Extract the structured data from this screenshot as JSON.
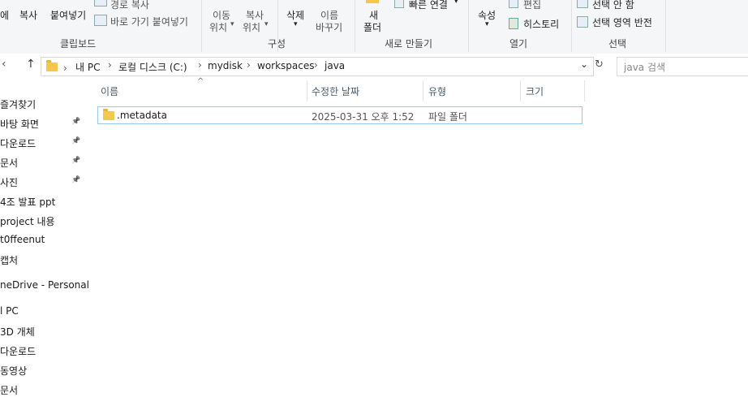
{
  "ribbon": {
    "clipboard": {
      "partial_label": "에",
      "copy": "복사",
      "paste": "붙여넣기",
      "copy_path": "경로 복사",
      "paste_shortcut": "바로 가기 붙여넣기",
      "group": "클립보드"
    },
    "organize": {
      "move_to": [
        "이동",
        "위치"
      ],
      "copy_to": [
        "복사",
        "위치"
      ],
      "delete": "삭제",
      "rename": [
        "이름",
        "바꾸기"
      ],
      "group": "구성"
    },
    "new": {
      "new_folder": [
        "새",
        "폴더"
      ],
      "easy_access": "빠른 연결",
      "group": "새로 만들기"
    },
    "open": {
      "properties": "속성",
      "edit": "편집",
      "history": "히스토리",
      "group": "열기"
    },
    "select": {
      "select_none": "선택 안 함",
      "invert": "선택 영역 반전",
      "group": "선택"
    }
  },
  "address": {
    "crumbs": [
      "내 PC",
      "로컬 디스크 (C:)",
      "mydisk",
      "workspaces",
      "java"
    ],
    "search_placeholder": "java 검색"
  },
  "nav": {
    "items": [
      {
        "label": "즐겨찾기",
        "pinned": false
      },
      {
        "label": "바탕 화면",
        "pinned": true
      },
      {
        "label": "다운로드",
        "pinned": true
      },
      {
        "label": "문서",
        "pinned": true
      },
      {
        "label": "사진",
        "pinned": true
      },
      {
        "label": "4조 발표 ppt",
        "pinned": false
      },
      {
        "label": "project 내용",
        "pinned": false
      },
      {
        "label": "t0ffeenut",
        "pinned": false
      },
      {
        "label": "캡처",
        "pinned": false
      },
      {
        "label": "neDrive - Personal",
        "pinned": false
      },
      {
        "label": "l PC",
        "pinned": false
      },
      {
        "label": "3D 개체",
        "pinned": false
      },
      {
        "label": "다운로드",
        "pinned": false
      },
      {
        "label": "동영상",
        "pinned": false
      },
      {
        "label": "문서",
        "pinned": false
      }
    ]
  },
  "columns": [
    "이름",
    "수정한 날짜",
    "유형",
    "크기"
  ],
  "files": [
    {
      "name": ".metadata",
      "modified": "2025-03-31 오후 1:52",
      "type": "파일 폴더",
      "size": ""
    }
  ],
  "colors": {
    "accent": "#99c9ef",
    "folder": "#f2c94c"
  }
}
